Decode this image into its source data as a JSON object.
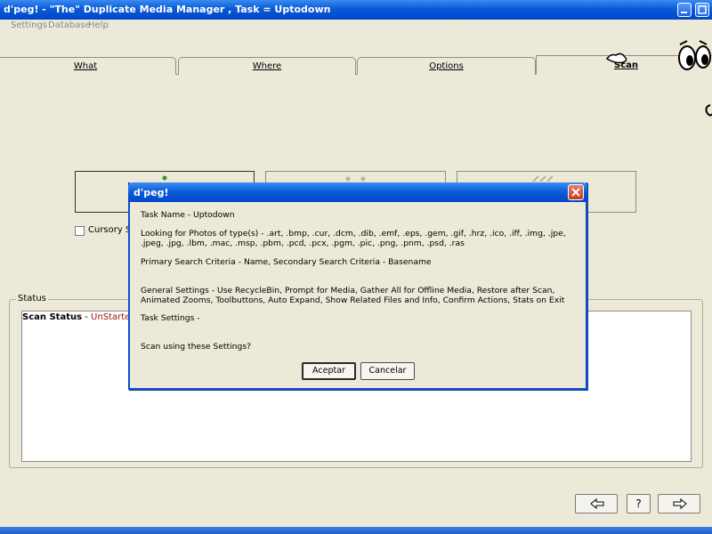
{
  "window": {
    "title": "d'peg! - \"The\" Duplicate Media Manager , Task = Uptodown"
  },
  "menu": {
    "items": [
      "Settings",
      "Database",
      "Help"
    ]
  },
  "tabs": {
    "what": "What",
    "where": "Where",
    "options": "Options",
    "scan": "Scan"
  },
  "main": {
    "cursory_label": "Cursory Sca",
    "status_caption": "Status",
    "scan_status_label": "Scan Status",
    "scan_status_sep": " - ",
    "scan_status_value": "UnStarted"
  },
  "nav": {
    "help_label": "?"
  },
  "dialog": {
    "title": "d'peg!",
    "task_name": "Task Name - Uptodown",
    "looking_for": "Looking for Photos of type(s) - .art, .bmp, .cur, .dcm, .dib, .emf, .eps, .gem, .gif, .hrz, .ico, .iff, .img, .jpe, .jpeg, .jpg, .lbm, .mac, .msp, .pbm, .pcd, .pcx, .pgm, .pic, .png, .pnm, .psd, .ras",
    "criteria": "Primary Search Criteria - Name, Secondary Search Criteria - Basename",
    "general_settings": "General Settings - Use RecycleBin, Prompt for Media, Gather All for Offline Media, Restore after Scan, Animated Zooms, Toolbuttons, Auto Expand, Show Related Files and Info, Confirm Actions, Stats on Exit",
    "task_settings": "Task Settings -",
    "question": "Scan using these Settings?",
    "ok_label": "Aceptar",
    "cancel_label": "Cancelar"
  },
  "colors": {
    "titlebar": "#0a5ad8",
    "status_value": "#a01010",
    "close": "#c63b1f"
  }
}
